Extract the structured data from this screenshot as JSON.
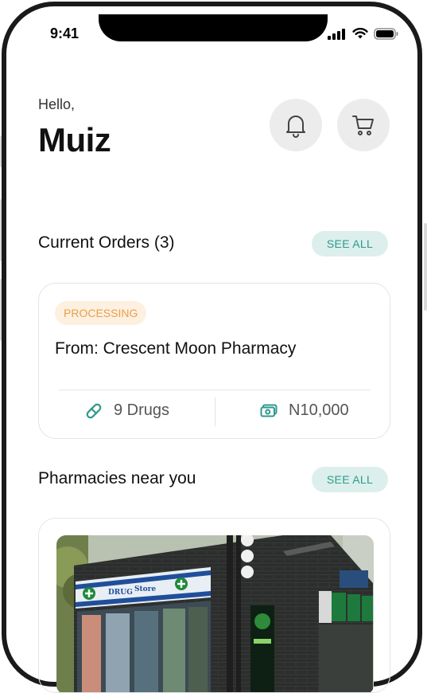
{
  "status_bar": {
    "time": "9:41"
  },
  "header": {
    "greeting": "Hello,",
    "name": "Muiz"
  },
  "current_orders": {
    "title": "Current Orders (3)",
    "see_all": "SEE ALL",
    "order": {
      "status": "PROCESSING",
      "from": "From: Crescent Moon Pharmacy",
      "drugs": "9 Drugs",
      "amount": "N10,000"
    }
  },
  "pharmacies": {
    "title": "Pharmacies near you",
    "see_all": "SEE ALL",
    "storefront_sign": {
      "left": "DRUG",
      "right": "Store"
    }
  },
  "colors": {
    "accent": "#2e9a8c",
    "accent_bg": "#dcefec",
    "processing": "#e9a04c",
    "processing_bg": "#fdf0e0"
  }
}
